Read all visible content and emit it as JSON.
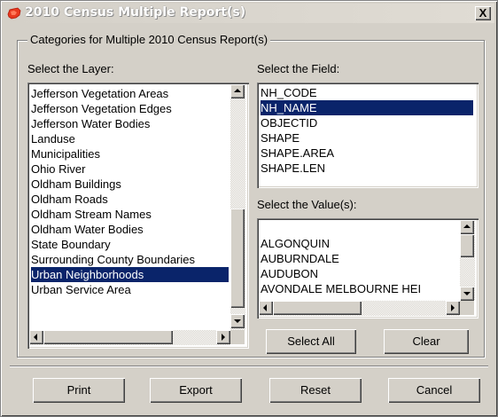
{
  "window": {
    "title": "2010 Census Multiple Report(s)",
    "close_label": "X"
  },
  "group": {
    "title": "Categories for Multiple 2010 Census Report(s)"
  },
  "layer": {
    "label": "Select the Layer:",
    "items": [
      "Jefferson Vegetation Areas",
      "Jefferson Vegetation Edges",
      "Jefferson Water Bodies",
      "Landuse",
      "Municipalities",
      "Ohio River",
      "Oldham Buildings",
      "Oldham Roads",
      "Oldham Stream Names",
      "Oldham Water Bodies",
      "State Boundary",
      "Surrounding County Boundaries",
      "Urban Neighborhoods",
      "Urban Service Area"
    ],
    "selected": "Urban Neighborhoods"
  },
  "field": {
    "label": "Select the Field:",
    "items": [
      "NH_CODE",
      "NH_NAME",
      "OBJECTID",
      "SHAPE",
      "SHAPE.AREA",
      "SHAPE.LEN"
    ],
    "selected": "NH_NAME"
  },
  "value": {
    "label": "Select the Value(s):",
    "items": [
      "",
      "ALGONQUIN",
      "AUBURNDALE",
      "AUDUBON",
      "AVONDALE MELBOURNE HEI"
    ]
  },
  "buttons": {
    "select_all": "Select All",
    "clear": "Clear",
    "print": "Print",
    "export": "Export",
    "reset": "Reset",
    "cancel": "Cancel"
  },
  "colors": {
    "selection": "#0a246a",
    "face": "#d4d0c8"
  }
}
